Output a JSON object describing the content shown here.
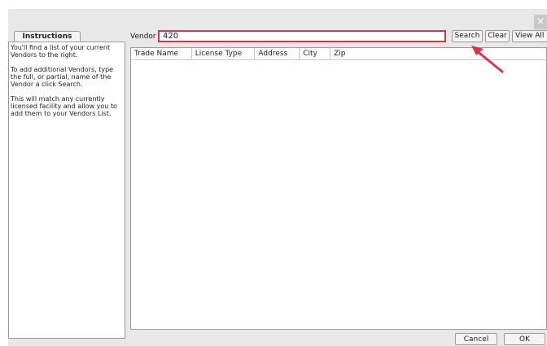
{
  "dialog": {
    "close_label": "✕"
  },
  "instructions": {
    "tab_label": "Instructions",
    "paragraphs": [
      "You'll find a list of your current Vendors to the right.",
      "To add additional Vendors, type the full, or partial, name of the Vendor a click Search.",
      "This will match any currently licensed facility and allow you to add them to your Vendors List."
    ]
  },
  "search": {
    "label": "Vendor",
    "value": "420",
    "search_label": "Search",
    "clear_label": "Clear",
    "view_all_label": "View All"
  },
  "table": {
    "columns": [
      "Trade Name",
      "License Type",
      "Address",
      "City",
      "Zip"
    ],
    "rows": []
  },
  "footer": {
    "cancel_label": "Cancel",
    "ok_label": "OK"
  },
  "colors": {
    "highlight": "#d9334e"
  }
}
